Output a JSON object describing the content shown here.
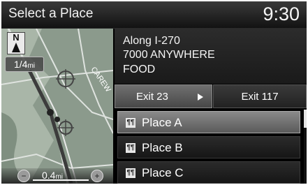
{
  "header": {
    "title": "Select a Place",
    "clock": "9:30"
  },
  "map": {
    "compass_label": "N",
    "scale_value": "1/4",
    "scale_unit": "mi",
    "distance_value": "0.4",
    "distance_unit": "mi",
    "street_label": "CAREW",
    "zoom_out_icon": "minus-icon",
    "zoom_in_icon": "plus-icon"
  },
  "info": {
    "line1": "Along I-270",
    "line2": "7000 ANYWHERE",
    "line3": "FOOD"
  },
  "exits": {
    "current": "Exit 23",
    "next": "Exit 117"
  },
  "places": [
    {
      "label": "Place A",
      "icon": "fork-knife-icon",
      "selected": true
    },
    {
      "label": "Place B",
      "icon": "fork-knife-icon",
      "selected": false
    },
    {
      "label": "Place C",
      "icon": "fork-knife-icon",
      "selected": false
    }
  ],
  "colors": {
    "map_bg": "#8b9a8c",
    "route": "#3c3c3c",
    "selected_row": "#7a7a7a",
    "exit_active": "#5c5c5c"
  }
}
